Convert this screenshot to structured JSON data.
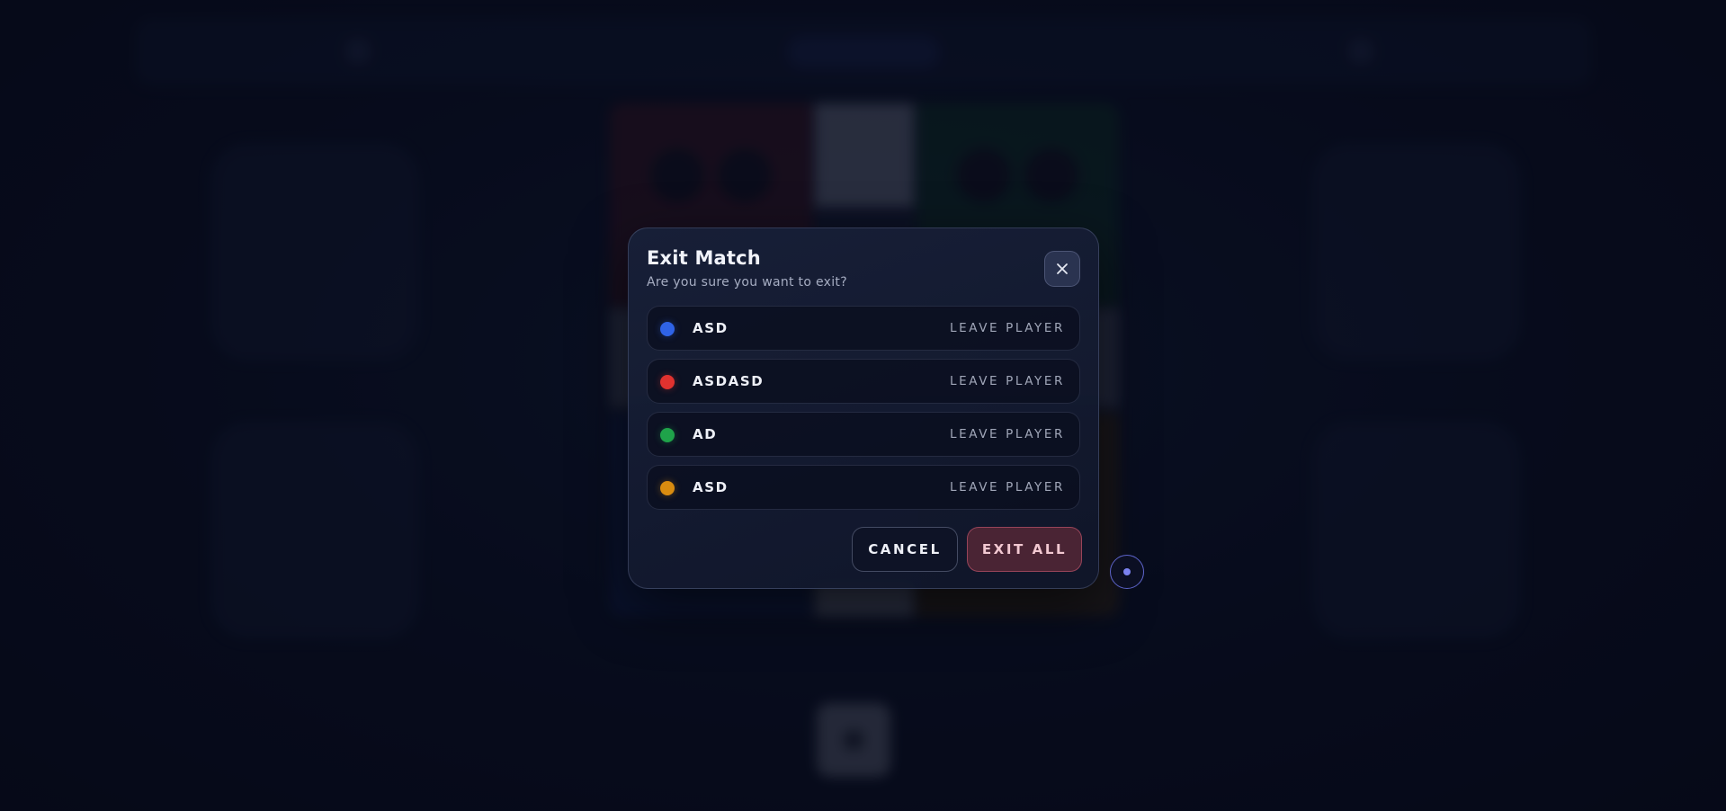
{
  "dialog": {
    "title": "Exit Match",
    "subtitle": "Are you sure you want to exit?",
    "close_icon": "close-icon"
  },
  "players": [
    {
      "name": "ASD",
      "color": "#2f63e6",
      "action_label": "LEAVE PLAYER"
    },
    {
      "name": "ASDASD",
      "color": "#e0322f",
      "action_label": "LEAVE PLAYER"
    },
    {
      "name": "AD",
      "color": "#1fa34a",
      "action_label": "LEAVE PLAYER"
    },
    {
      "name": "ASD",
      "color": "#d98c10",
      "action_label": "LEAVE PLAYER"
    }
  ],
  "actions": {
    "cancel_label": "CANCEL",
    "exit_all_label": "EXIT ALL"
  },
  "colors": {
    "accent_danger": "#cd5a73",
    "indicator": "#7b82ef"
  }
}
